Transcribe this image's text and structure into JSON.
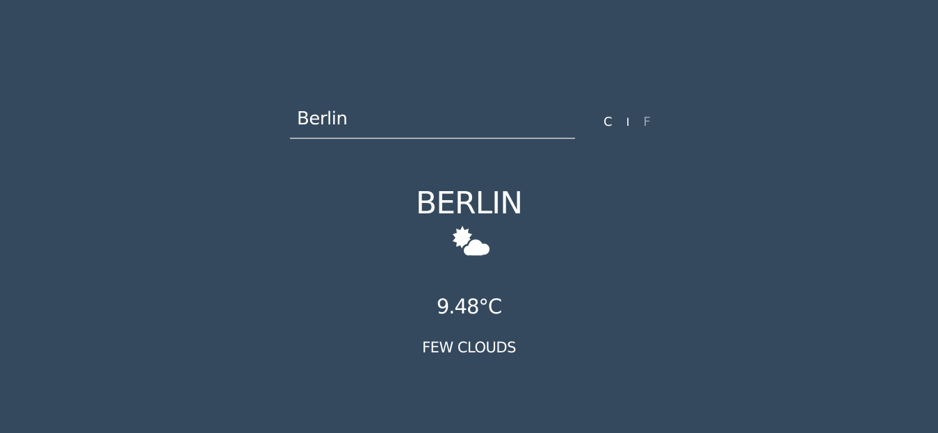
{
  "search": {
    "value": "Berlin",
    "placeholder": ""
  },
  "units": {
    "celsius_label": "C",
    "separator": "I",
    "fahrenheit_label": "F",
    "active": "C"
  },
  "weather": {
    "city": "BERLIN",
    "icon": "few-clouds-icon",
    "temperature": "9.48°C",
    "description": "FEW CLOUDS"
  },
  "colors": {
    "background": "#35495e",
    "text": "#ffffff",
    "inactive_unit": "#9aa6b2",
    "underline": "#a9b1bb"
  }
}
